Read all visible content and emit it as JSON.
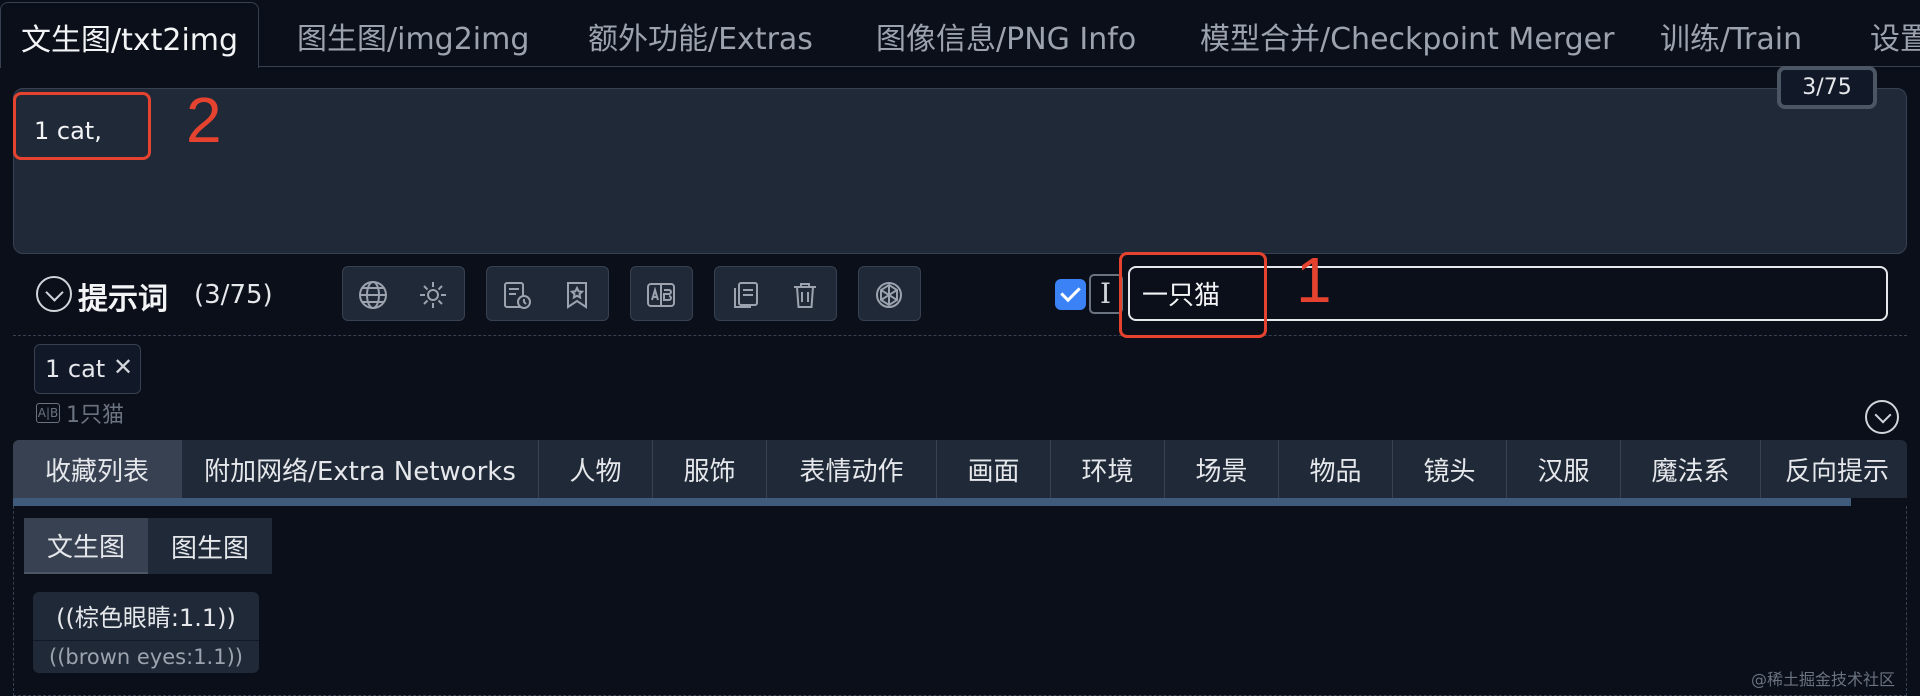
{
  "top_tabs": [
    "文生图/txt2img",
    "图生图/img2img",
    "额外功能/Extras",
    "图像信息/PNG Info",
    "模型合并/Checkpoint Merger",
    "训练/Train",
    "设置"
  ],
  "prompt": {
    "text": "1 cat,",
    "token_counter": "3/75"
  },
  "annotations": [
    "2",
    "1"
  ],
  "helper": {
    "title": "提示词",
    "count": "(3/75)",
    "checkbox_checked": true,
    "translate_input": "一只猫"
  },
  "tags": [
    {
      "label": "1 cat",
      "close": "✕",
      "translation": "1只猫",
      "translate_icon": "A|B"
    }
  ],
  "category_tabs": [
    "收藏列表",
    "附加网络/Extra Networks",
    "人物",
    "服饰",
    "表情动作",
    "画面",
    "环境",
    "场景",
    "物品",
    "镜头",
    "汉服",
    "魔法系",
    "反向提示"
  ],
  "sub_tabs": [
    "文生图",
    "图生图"
  ],
  "phrases": [
    {
      "main": "((棕色眼睛:1.1))",
      "sub": "((brown eyes:1.1))"
    }
  ],
  "watermark": "@稀土掘金技术社区",
  "icons": [
    "globe-icon",
    "gear-icon",
    "history-icon",
    "bookmark-icon",
    "translate-icon",
    "copy-icon",
    "trash-icon",
    "openai-icon"
  ],
  "colors": {
    "annotation": "#e5432f",
    "accent": "#3b82f6",
    "background": "#0b0f19"
  }
}
